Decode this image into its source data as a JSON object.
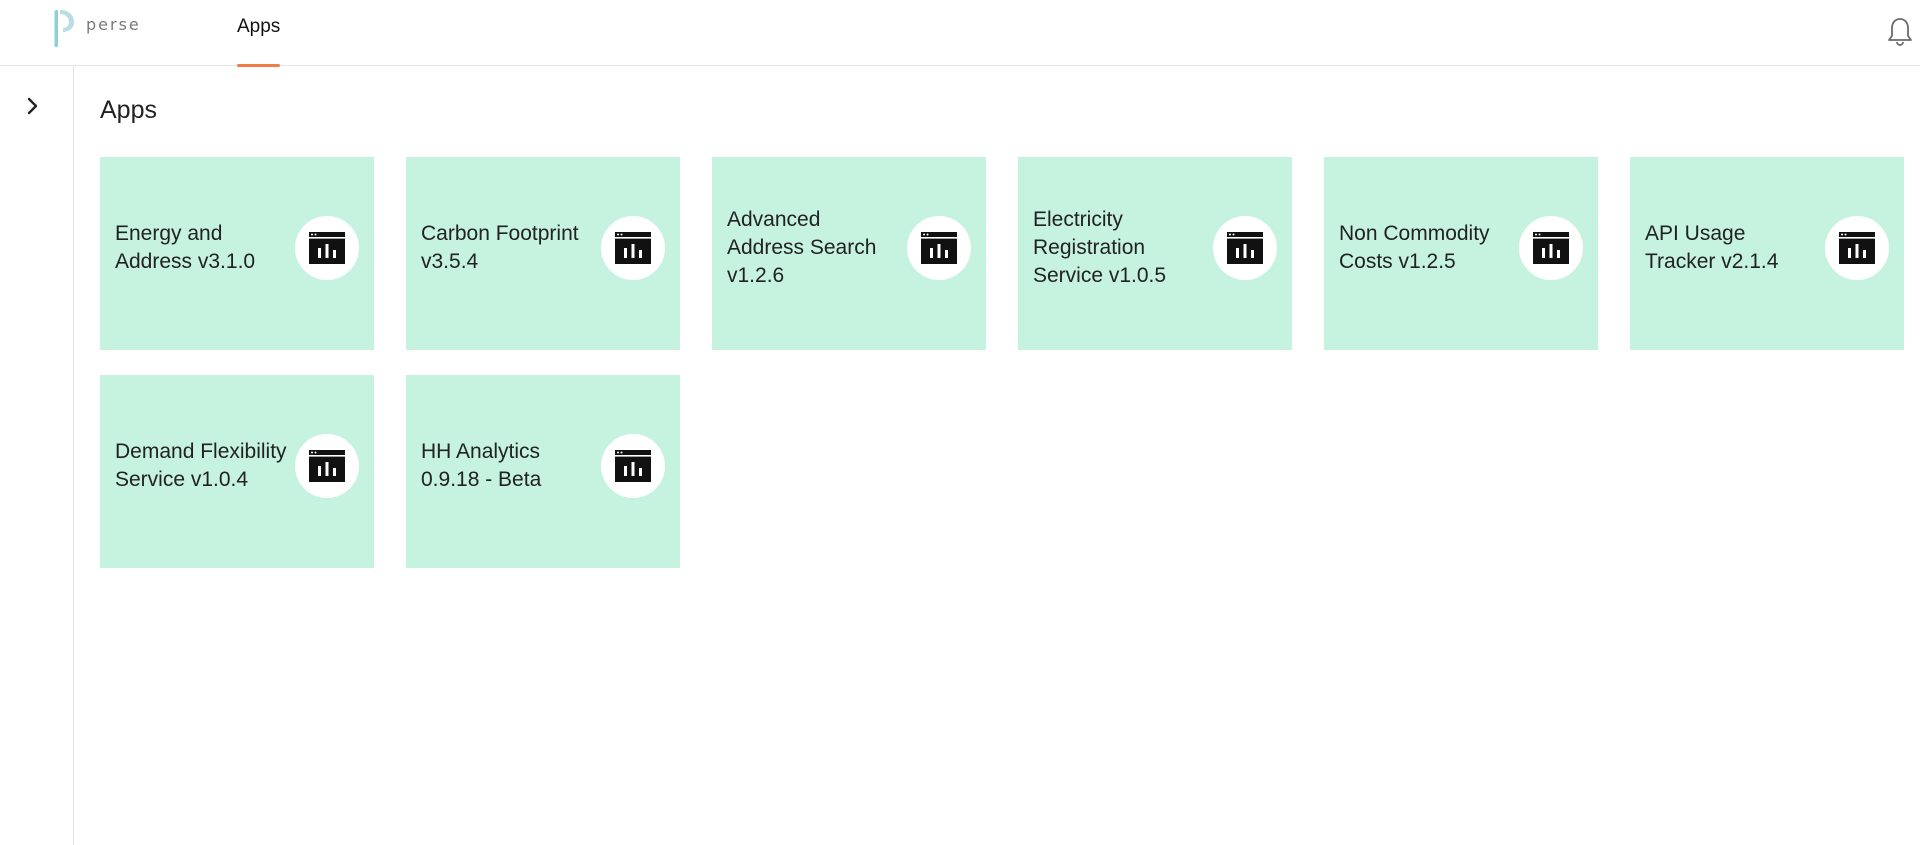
{
  "header": {
    "logo_text": "perse",
    "nav_tab_label": "Apps",
    "accent_color": "#f07c4a"
  },
  "main": {
    "title": "Apps",
    "card_color": "#c6f2e0",
    "cards": [
      {
        "title": "Energy and Address v3.1.0",
        "icon": "dashboard-chart-icon"
      },
      {
        "title": "Carbon Footprint v3.5.4",
        "icon": "dashboard-chart-icon"
      },
      {
        "title": "Advanced Address Search v1.2.6",
        "icon": "dashboard-chart-icon"
      },
      {
        "title": "Electricity Registration Service v1.0.5",
        "icon": "dashboard-chart-icon"
      },
      {
        "title": "Non Commodity Costs v1.2.5",
        "icon": "dashboard-chart-icon"
      },
      {
        "title": "API Usage Tracker v2.1.4",
        "icon": "dashboard-chart-icon"
      },
      {
        "title": "Demand Flexibility Service v1.0.4",
        "icon": "dashboard-chart-icon"
      },
      {
        "title": "HH Analytics 0.9.18 - Beta",
        "icon": "dashboard-chart-icon"
      }
    ]
  },
  "icons": {
    "logo": "perse-logo-icon",
    "bell": "bell-icon",
    "sidebar_toggle": "chevron-right-icon"
  }
}
